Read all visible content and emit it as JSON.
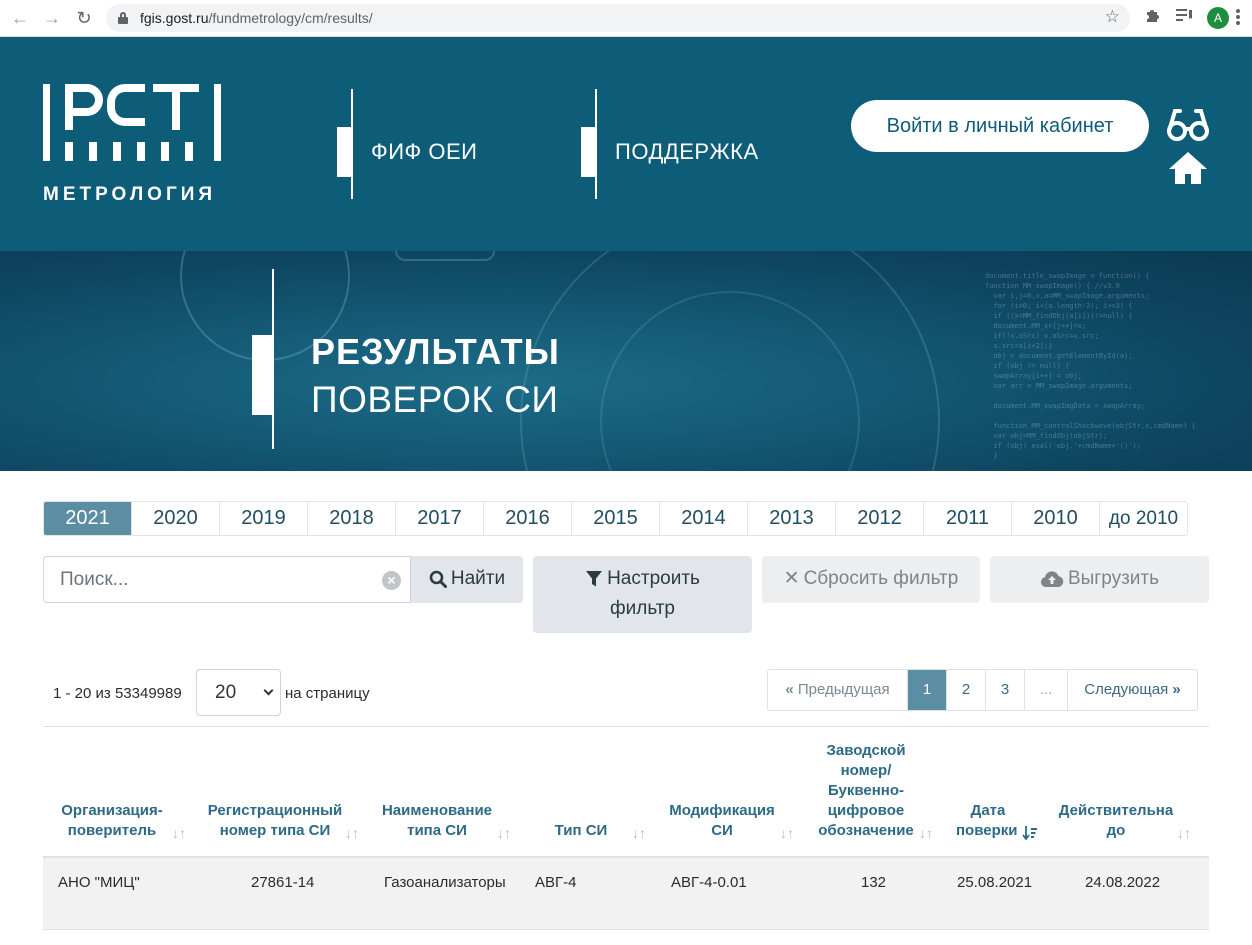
{
  "browser": {
    "url_host": "fgis.gost.ru",
    "url_path": "/fundmetrology/cm/results/",
    "profile_initial": "A"
  },
  "header": {
    "logo_letters": "РСТ",
    "logo_tagline": "МЕТРОЛОГИЯ",
    "nav": [
      {
        "label": "ФИФ ОЕИ"
      },
      {
        "label": "ПОДДЕРЖКА"
      }
    ],
    "login_label": "Войти в личный кабинет",
    "icons": [
      "glasses-icon",
      "home-icon"
    ]
  },
  "banner": {
    "title_bold": "РЕЗУЛЬТАТЫ",
    "title_light": "ПОВЕРОК СИ"
  },
  "years": [
    "2021",
    "2020",
    "2019",
    "2018",
    "2017",
    "2016",
    "2015",
    "2014",
    "2013",
    "2012",
    "2011",
    "2010",
    "до 2010"
  ],
  "active_year": "2021",
  "search": {
    "placeholder": "Поиск...",
    "find_label": "Найти",
    "filter_label_line1": "Настроить",
    "filter_label_line2": "фильтр",
    "reset_label": "Сбросить фильтр",
    "export_label": "Выгрузить"
  },
  "results": {
    "count_text": "1 - 20 из 53349989",
    "page_size": "20",
    "per_page_label": "на страницу"
  },
  "pagination": {
    "prev_label": "Предыдущая",
    "pages": [
      "1",
      "2",
      "3"
    ],
    "active_page": "1",
    "ellipsis": "...",
    "next_label": "Следующая"
  },
  "table": {
    "columns": [
      {
        "line1": "Организация-",
        "line2": "поверитель"
      },
      {
        "line1": "Регистрационный",
        "line2": "номер типа СИ"
      },
      {
        "line1": "Наименование",
        "line2": "типа СИ"
      },
      {
        "line1": "Тип СИ"
      },
      {
        "line1": "Модификация",
        "line2": "СИ"
      },
      {
        "line1": "Заводской",
        "line2": "номер/",
        "line3": "Буквенно-",
        "line4": "цифровое",
        "line5": "обозначение"
      },
      {
        "line1": "Дата",
        "line2": "поверки"
      },
      {
        "line1": "Действительна",
        "line2": "до"
      }
    ],
    "rows": [
      [
        "АНО \"МИЦ\"",
        "27861-14",
        "Газоанализаторы",
        "АВГ-4",
        "АВГ-4-0.01",
        "132",
        "25.08.2021",
        "24.08.2022"
      ]
    ]
  },
  "colors": {
    "header_bg": "#0d5c78",
    "accent": "#5b8da3",
    "link": "#2c6a86"
  }
}
